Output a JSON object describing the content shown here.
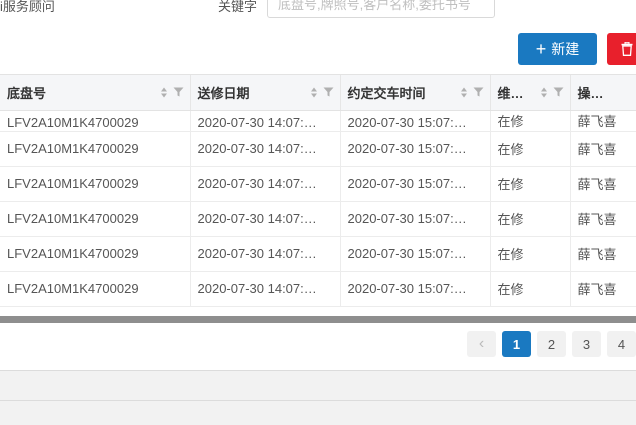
{
  "filters": {
    "left_label": "i服务顾问",
    "keyword_label": "关键字",
    "keyword_placeholder": "底盘号,牌照号,客户名称,委托书号"
  },
  "toolbar": {
    "new_label": "新建",
    "new_icon": "plus-icon",
    "delete_icon": "trash-icon",
    "primary_color": "#1a79c1",
    "danger_color": "#e8202c"
  },
  "table": {
    "columns": [
      {
        "label": "底盘号"
      },
      {
        "label": "送修日期"
      },
      {
        "label": "约定交车时间"
      },
      {
        "label": "维…"
      },
      {
        "label": "操…"
      }
    ],
    "rows": [
      {
        "vin": "LFV2A10M1K4700029",
        "repair_date": "2020-07-30 14:07:…",
        "delivery_time": "2020-07-30 15:07:…",
        "status": "在修",
        "operator": "薛飞喜"
      },
      {
        "vin": "LFV2A10M1K4700029",
        "repair_date": "2020-07-30 14:07:…",
        "delivery_time": "2020-07-30 15:07:…",
        "status": "在修",
        "operator": "薛飞喜"
      },
      {
        "vin": "LFV2A10M1K4700029",
        "repair_date": "2020-07-30 14:07:…",
        "delivery_time": "2020-07-30 15:07:…",
        "status": "在修",
        "operator": "薛飞喜"
      },
      {
        "vin": "LFV2A10M1K4700029",
        "repair_date": "2020-07-30 14:07:…",
        "delivery_time": "2020-07-30 15:07:…",
        "status": "在修",
        "operator": "薛飞喜"
      },
      {
        "vin": "LFV2A10M1K4700029",
        "repair_date": "2020-07-30 14:07:…",
        "delivery_time": "2020-07-30 15:07:…",
        "status": "在修",
        "operator": "薛飞喜"
      },
      {
        "vin": "LFV2A10M1K4700029",
        "repair_date": "2020-07-30 14:07:…",
        "delivery_time": "2020-07-30 15:07:…",
        "status": "在修",
        "operator": "薛飞喜"
      }
    ]
  },
  "pagination": {
    "prev_label": "‹",
    "pages": [
      "1",
      "2",
      "3",
      "4"
    ],
    "current": "1"
  }
}
